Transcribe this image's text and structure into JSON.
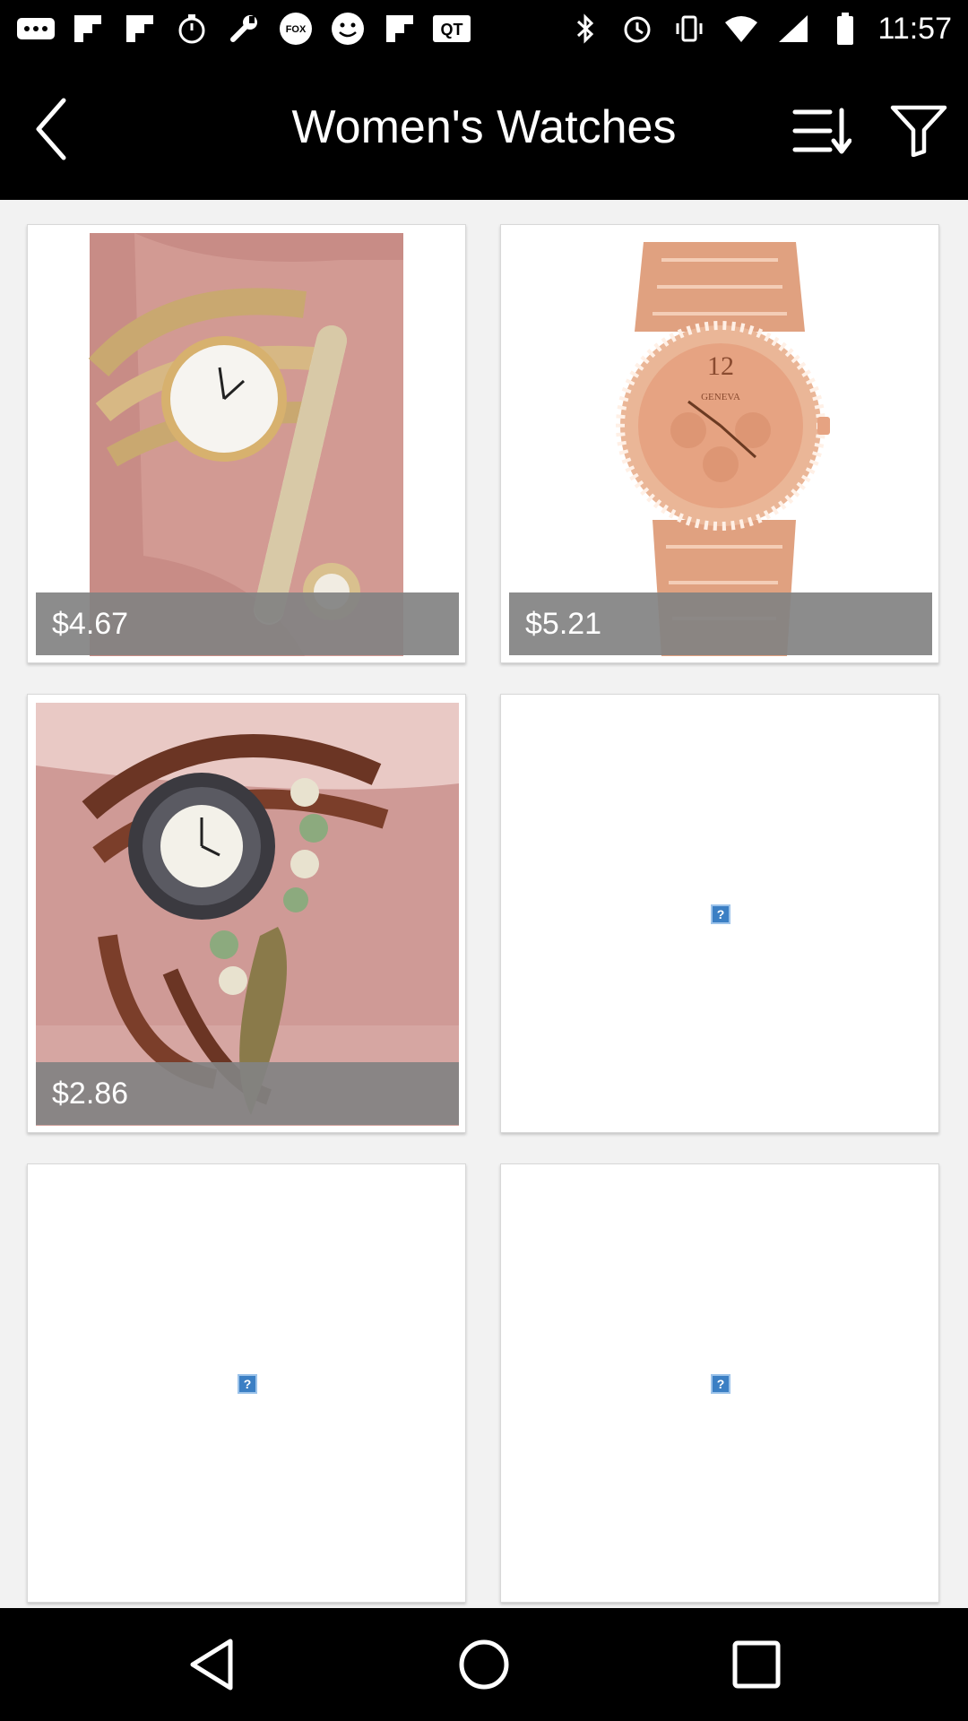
{
  "status_bar": {
    "time": "11:57",
    "left_icons": [
      "more-dots-icon",
      "flipboard-icon",
      "flipboard-icon",
      "timer-icon",
      "wrench-icon",
      "fox-sports-icon",
      "smiley-icon",
      "flipboard-icon",
      "qt-icon"
    ],
    "right_icons": [
      "bluetooth-icon",
      "alarm-icon",
      "vibrate-icon",
      "wifi-icon",
      "signal-icon",
      "battery-icon"
    ]
  },
  "app_bar": {
    "title": "Women's Watches",
    "back_icon": "chevron-left-icon",
    "sort_icon": "sort-icon",
    "filter_icon": "filter-icon"
  },
  "products": [
    {
      "price": "$4.67",
      "image": "wrap-bracelet-watch-gold"
    },
    {
      "price": "$5.21",
      "image": "rose-gold-geneva-watch"
    },
    {
      "price": "$2.86",
      "image": "vintage-leather-wrap-watch"
    },
    {
      "price": "",
      "image": "broken-image-placeholder"
    },
    {
      "price": "",
      "image": "broken-image-placeholder"
    },
    {
      "price": "",
      "image": "broken-image-placeholder"
    }
  ],
  "nav_bar": {
    "back": "triangle-back-icon",
    "home": "circle-home-icon",
    "recents": "square-recents-icon"
  },
  "colors": {
    "bar_background": "#000000",
    "page_background": "#f2f2f2",
    "price_overlay": "#828282",
    "placeholder_blue": "#3b7fc4"
  }
}
